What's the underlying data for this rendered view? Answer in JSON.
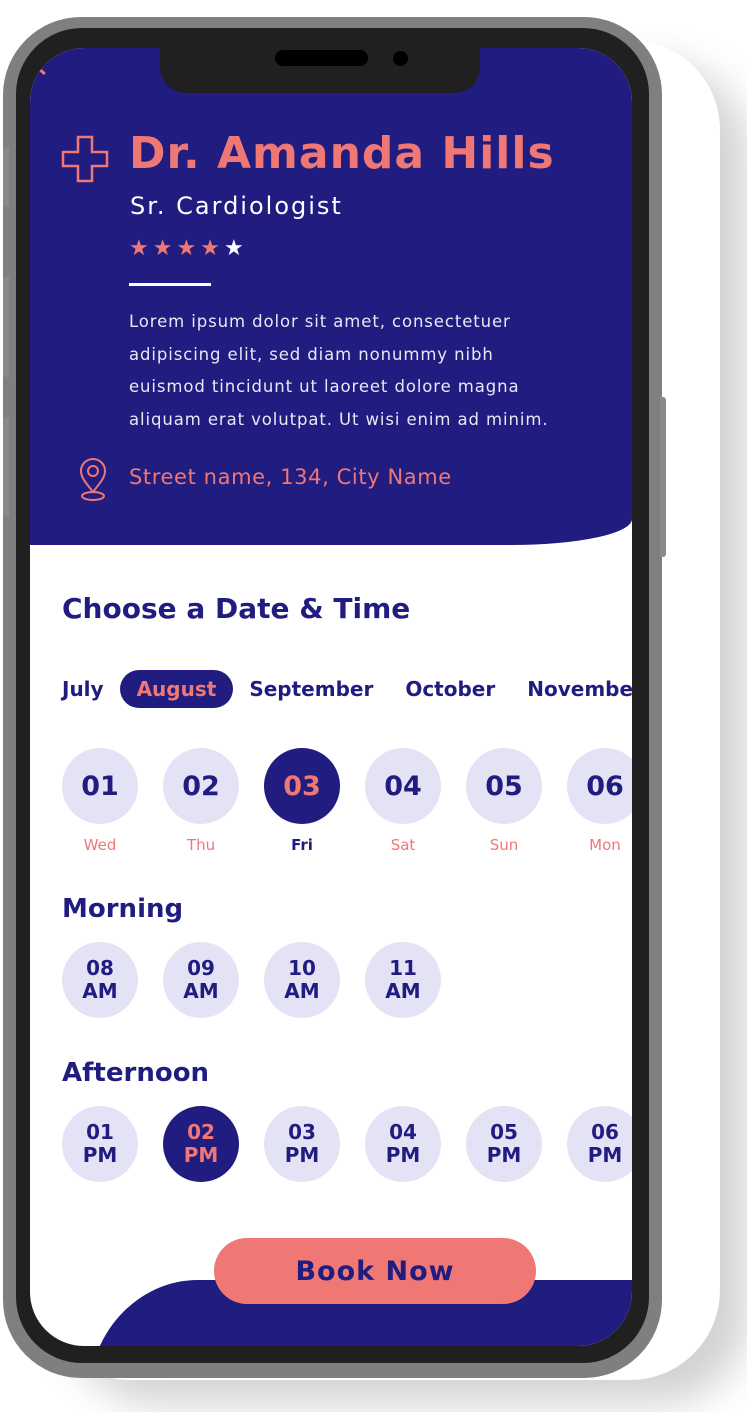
{
  "colors": {
    "primary": "#211c80",
    "accent": "#ef7774",
    "slot_bg": "#e4e3f6",
    "text_light": "#ffffff"
  },
  "doctor": {
    "name": "Dr. Amanda Hills",
    "title": "Sr. Cardiologist",
    "rating": 4,
    "rating_max": 5,
    "bio": "Lorem ipsum dolor sit amet, consectetuer adipiscing elit, sed diam nonummy nibh euismod tincidunt ut laoreet dolore magna aliquam erat volutpat. Ut wisi enim ad minim.",
    "bio_lines": [
      "Lorem ipsum dolor sit amet, consectetuer",
      "adipiscing elit, sed diam nonummy nibh",
      "euismod tincidunt ut laoreet dolore magna",
      "aliquam erat volutpat. Ut wisi enim ad minim."
    ],
    "address": "Street name, 134, City Name",
    "icon": "medical-cross-icon",
    "location_icon": "map-pin-icon"
  },
  "booking": {
    "heading": "Choose a Date & Time",
    "months": [
      {
        "label": "July",
        "selected": false
      },
      {
        "label": "August",
        "selected": true
      },
      {
        "label": "September",
        "selected": false
      },
      {
        "label": "October",
        "selected": false
      },
      {
        "label": "November",
        "selected": false
      }
    ],
    "dates": [
      {
        "num": "01",
        "day": "Wed",
        "selected": false
      },
      {
        "num": "02",
        "day": "Thu",
        "selected": false
      },
      {
        "num": "03",
        "day": "Fri",
        "selected": true
      },
      {
        "num": "04",
        "day": "Sat",
        "selected": false
      },
      {
        "num": "05",
        "day": "Sun",
        "selected": false
      },
      {
        "num": "06",
        "day": "Mon",
        "selected": false
      }
    ],
    "morning": {
      "label": "Morning",
      "slots": [
        {
          "hour": "08",
          "period": "AM",
          "selected": false
        },
        {
          "hour": "09",
          "period": "AM",
          "selected": false
        },
        {
          "hour": "10",
          "period": "AM",
          "selected": false
        },
        {
          "hour": "11",
          "period": "AM",
          "selected": false
        }
      ]
    },
    "afternoon": {
      "label": "Afternoon",
      "slots": [
        {
          "hour": "01",
          "period": "PM",
          "selected": false
        },
        {
          "hour": "02",
          "period": "PM",
          "selected": true
        },
        {
          "hour": "03",
          "period": "PM",
          "selected": false
        },
        {
          "hour": "04",
          "period": "PM",
          "selected": false
        },
        {
          "hour": "05",
          "period": "PM",
          "selected": false
        },
        {
          "hour": "06",
          "period": "PM",
          "selected": false
        }
      ]
    },
    "book_label": "Book Now"
  }
}
